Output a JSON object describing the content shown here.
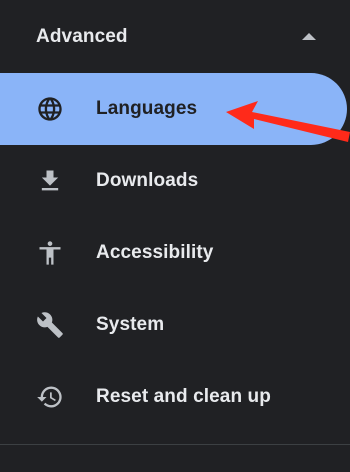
{
  "section": {
    "title": "Advanced",
    "expanded_icon": "chevron-up-icon"
  },
  "nav": {
    "items": [
      {
        "label": "Languages",
        "icon": "globe-icon",
        "active": true
      },
      {
        "label": "Downloads",
        "icon": "download-icon",
        "active": false
      },
      {
        "label": "Accessibility",
        "icon": "accessibility-icon",
        "active": false
      },
      {
        "label": "System",
        "icon": "wrench-icon",
        "active": false
      },
      {
        "label": "Reset and clean up",
        "icon": "restore-icon",
        "active": false
      }
    ]
  },
  "colors": {
    "background": "#202124",
    "active_item": "#8ab4f8",
    "text": "#e8eaed",
    "active_text": "#202124",
    "annotation_arrow": "#ff2a1a"
  }
}
